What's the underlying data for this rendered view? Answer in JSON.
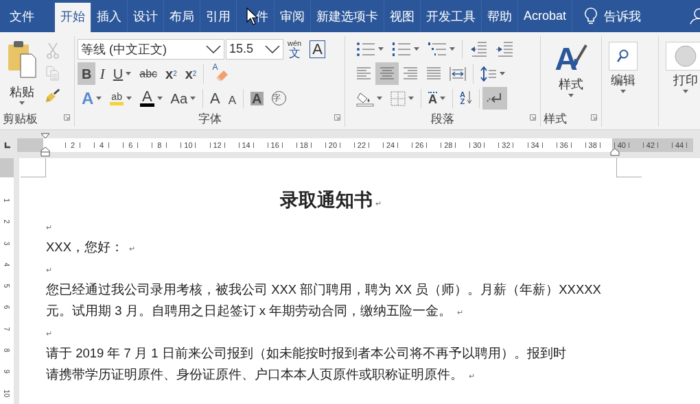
{
  "tabs": [
    {
      "label": "文件",
      "selected": false
    },
    {
      "label": "开始",
      "selected": true
    },
    {
      "label": "插入",
      "selected": false
    },
    {
      "label": "设计",
      "selected": false
    },
    {
      "label": "布局",
      "selected": false
    },
    {
      "label": "引用",
      "selected": false
    },
    {
      "label": "件",
      "selected": false
    },
    {
      "label": "审阅",
      "selected": false
    },
    {
      "label": "新建选项卡",
      "selected": false
    },
    {
      "label": "视图",
      "selected": false
    },
    {
      "label": "开发工具",
      "selected": false
    },
    {
      "label": "帮助",
      "selected": false
    },
    {
      "label": "Acrobat",
      "selected": false
    }
  ],
  "tell_me": {
    "label": "告诉我"
  },
  "clipboard": {
    "label": "剪贴板",
    "paste": "粘贴",
    "tools": [
      {
        "kind": "cut",
        "disabled": true
      },
      {
        "kind": "copy",
        "disabled": true
      },
      {
        "kind": "painter",
        "disabled": false
      }
    ]
  },
  "font": {
    "label": "字体",
    "font_name": "等线 (中文正文)",
    "font_size": "15.5",
    "phonetic_top": "wén",
    "phonetic_char": "文",
    "border_char": "A",
    "row2": [
      {
        "kind": "bold",
        "label": "B",
        "selected": true
      },
      {
        "kind": "italic",
        "label": "I",
        "selected": false
      },
      {
        "kind": "underline",
        "label": "U",
        "selected": false,
        "dropdown": true
      },
      {
        "kind": "strike",
        "label": "abc",
        "selected": false
      },
      {
        "kind": "sub",
        "label": "x",
        "script": "2",
        "selected": false
      },
      {
        "kind": "sup",
        "label": "x",
        "script": "2",
        "selected": false
      },
      {
        "kind": "sep"
      },
      {
        "kind": "clear",
        "label": "A"
      }
    ],
    "row3": [
      {
        "kind": "effects",
        "label": "A",
        "dropdown": true
      },
      {
        "kind": "highlight",
        "label": "ab",
        "dropdown": true
      },
      {
        "kind": "color",
        "label": "A",
        "dropdown": true
      },
      {
        "kind": "case",
        "label": "Aa",
        "dropdown": true
      },
      {
        "kind": "sep"
      },
      {
        "kind": "grow",
        "label": "A"
      },
      {
        "kind": "shrink",
        "label": "A"
      },
      {
        "kind": "sep"
      },
      {
        "kind": "shading",
        "label": "A"
      },
      {
        "kind": "enclose",
        "label": "字"
      }
    ]
  },
  "paragraph": {
    "label": "段落",
    "row1": [
      {
        "kind": "bullets",
        "dropdown": true
      },
      {
        "kind": "numbering",
        "dropdown": true
      },
      {
        "kind": "multilevel",
        "dropdown": true
      },
      {
        "kind": "sep"
      },
      {
        "kind": "outdent"
      },
      {
        "kind": "indent"
      }
    ],
    "row2": [
      {
        "kind": "left",
        "selected": false
      },
      {
        "kind": "center",
        "selected": true
      },
      {
        "kind": "right",
        "selected": false
      },
      {
        "kind": "justify",
        "selected": false
      },
      {
        "kind": "distributed",
        "selected": false
      },
      {
        "kind": "sep"
      },
      {
        "kind": "spacing",
        "dropdown": true
      }
    ],
    "row3": [
      {
        "kind": "fill",
        "dropdown": true
      },
      {
        "kind": "borders",
        "dropdown": true
      },
      {
        "kind": "sep"
      },
      {
        "kind": "direction",
        "label": "A",
        "dropdown": true
      },
      {
        "kind": "sep"
      },
      {
        "kind": "sort",
        "label": "A",
        "label2": "Z"
      },
      {
        "kind": "sep"
      },
      {
        "kind": "marks",
        "selected": true
      }
    ]
  },
  "styles": {
    "label": "样式",
    "glyph": "A",
    "button": "样式"
  },
  "editing": {
    "button": "编辑"
  },
  "print_preview": {
    "button": "打印"
  },
  "ruler": {
    "labels": [
      "2",
      "4",
      "6",
      "8",
      "10",
      "12",
      "14",
      "16",
      "18",
      "20",
      "22",
      "24",
      "26",
      "28",
      "30",
      "32",
      "34",
      "36",
      "38",
      "40",
      "42",
      "44"
    ]
  },
  "vertical_ruler": {
    "labels": [
      "1",
      "2",
      "3",
      "4",
      "5",
      "6",
      "7",
      "8",
      "9",
      "10"
    ]
  },
  "document": {
    "title": "录取通知书",
    "title_mark": "↵",
    "paragraphs": [
      {
        "mark": "↵"
      },
      {
        "lines": [
          "XXX，您好："
        ],
        "mark": "↵"
      },
      {
        "mark": "↵"
      },
      {
        "lines": [
          "您已经通过我公司录用考核，被我公司 XXX 部门聘用，聘为 XX 员（师）。月薪（年薪）XXXXX",
          "元。试用期 3 月。自聘用之日起签订 x 年期劳动合同，缴纳五险一金。"
        ],
        "mark": "↵"
      },
      {
        "mark": "↵"
      },
      {
        "lines": [
          "请于 2019 年 7 月 1 日前来公司报到（如未能按时报到者本公司将不再予以聘用）。报到时",
          "请携带学历证明原件、身份证原件、户口本本人页原件或职称证明原件。"
        ],
        "mark": "↵"
      }
    ]
  }
}
